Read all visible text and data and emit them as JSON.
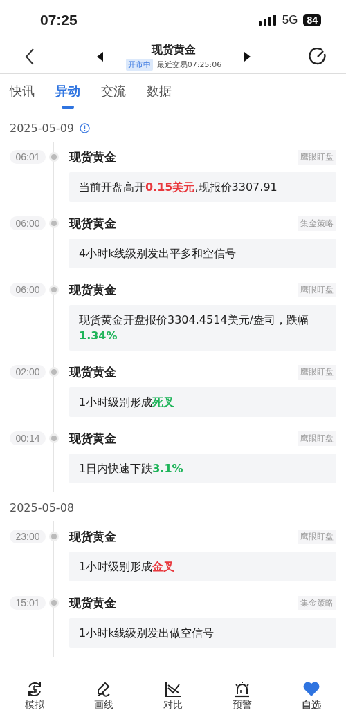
{
  "status_bar": {
    "time": "07:25",
    "network": "5G",
    "battery": "84"
  },
  "header": {
    "title": "现货黄金",
    "market_state": "开市中",
    "last_trade": "最近交易07:25:06"
  },
  "tabs": [
    {
      "label": "快讯",
      "selected": false
    },
    {
      "label": "异动",
      "selected": true
    },
    {
      "label": "交流",
      "selected": false
    },
    {
      "label": "数据",
      "selected": false
    }
  ],
  "groups": [
    {
      "date": "2025-05-09",
      "info": true,
      "events": [
        {
          "time": "06:01",
          "title": "现货黄金",
          "tag": "鹰眼盯盘",
          "body": [
            {
              "text": "当前开盘高开"
            },
            {
              "text": "0.15美元",
              "color": "#e8383d"
            },
            {
              "text": ",现报价3307.91"
            }
          ]
        },
        {
          "time": "06:00",
          "title": "现货黄金",
          "tag": "集金策略",
          "body": [
            {
              "text": "4小时k线级别发出平多和空信号"
            }
          ]
        },
        {
          "time": "06:00",
          "title": "现货黄金",
          "tag": "鹰眼盯盘",
          "body": [
            {
              "text": "现货黄金开盘报价3304.4514美元/盎司，跌幅"
            },
            {
              "text": "1.34%",
              "color": "#1fb45a"
            }
          ]
        },
        {
          "time": "02:00",
          "title": "现货黄金",
          "tag": "鹰眼盯盘",
          "body": [
            {
              "text": "1小时级别形成"
            },
            {
              "text": "死叉",
              "color": "#1fb45a"
            }
          ]
        },
        {
          "time": "00:14",
          "title": "现货黄金",
          "tag": "鹰眼盯盘",
          "body": [
            {
              "text": "1日内快速下跌"
            },
            {
              "text": "3.1%",
              "color": "#1fb45a"
            }
          ]
        }
      ]
    },
    {
      "date": "2025-05-08",
      "info": false,
      "events": [
        {
          "time": "23:00",
          "title": "现货黄金",
          "tag": "鹰眼盯盘",
          "body": [
            {
              "text": "1小时级别形成"
            },
            {
              "text": "金叉",
              "color": "#e8383d"
            }
          ]
        },
        {
          "time": "15:01",
          "title": "现货黄金",
          "tag": "集金策略",
          "body": [
            {
              "text": "1小时k线级别发出做空信号"
            }
          ]
        }
      ]
    }
  ],
  "bottom_nav": [
    {
      "label": "模拟",
      "kind": "dollar",
      "selected": false
    },
    {
      "label": "画线",
      "kind": "pen",
      "selected": false
    },
    {
      "label": "对比",
      "kind": "chart",
      "selected": false
    },
    {
      "label": "预警",
      "kind": "alarm",
      "selected": false
    },
    {
      "label": "自选",
      "kind": "heart",
      "selected": true
    }
  ]
}
